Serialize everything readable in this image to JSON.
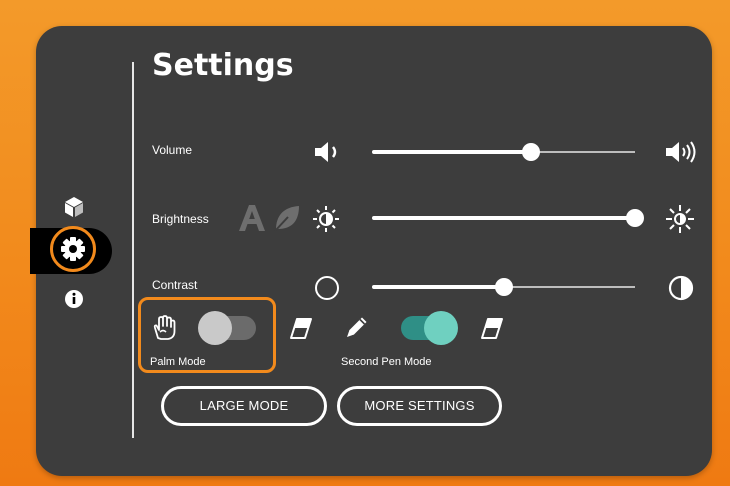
{
  "title": "Settings",
  "sidebar": {
    "items": [
      {
        "icon": "cube-icon"
      },
      {
        "icon": "gear-icon",
        "selected": true
      },
      {
        "icon": "info-icon"
      }
    ]
  },
  "rows": {
    "volume": {
      "label": "Volume",
      "value_fraction": 0.61,
      "min_icon": "speaker-low-icon",
      "max_icon": "speaker-high-icon"
    },
    "brightness": {
      "label": "Brightness",
      "value_fraction": 1.0,
      "auto_icon": "auto-brightness-a-icon",
      "eco_icon": "leaf-icon",
      "min_icon": "sun-dim-icon",
      "max_icon": "sun-bright-icon"
    },
    "contrast": {
      "label": "Contrast",
      "value_fraction": 0.5,
      "min_icon": "circle-outline-icon",
      "max_icon": "half-circle-icon"
    }
  },
  "palm_mode": {
    "label": "Palm Mode",
    "enabled": false,
    "icon": "palm-hand-icon",
    "end_icon": "eraser-icon"
  },
  "second_pen_mode": {
    "label": "Second Pen Mode",
    "enabled": true,
    "icon": "pencil-icon",
    "end_icon": "eraser-icon"
  },
  "buttons": {
    "large_mode": "LARGE MODE",
    "more_settings": "MORE SETTINGS"
  },
  "colors": {
    "accent": "#f28a1c",
    "toggle_on": "#6fd0c0",
    "panel": "#3d3d3d"
  }
}
